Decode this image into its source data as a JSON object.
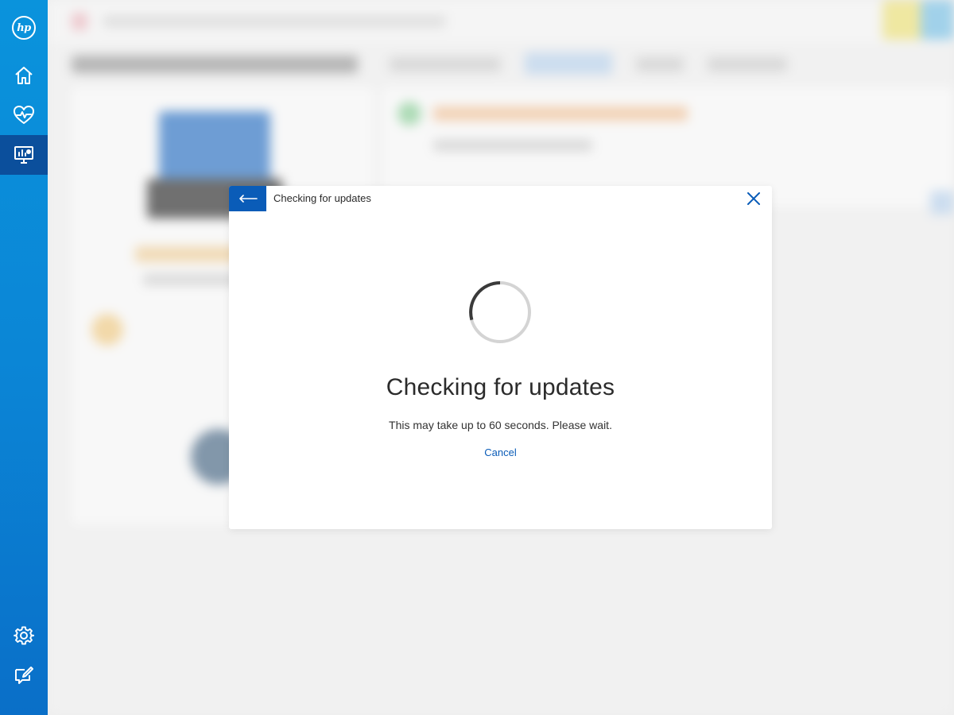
{
  "sidebar": {
    "logo": "hp",
    "items": [
      {
        "name": "home-icon"
      },
      {
        "name": "health-icon"
      },
      {
        "name": "device-support-icon",
        "active": true
      }
    ],
    "bottom_items": [
      {
        "name": "gear-icon"
      },
      {
        "name": "feedback-icon"
      }
    ]
  },
  "dialog": {
    "header_title": "Checking for updates",
    "title": "Checking for updates",
    "subtitle": "This may take up to 60 seconds. Please wait.",
    "cancel_label": "Cancel"
  },
  "colors": {
    "sidebar_top": "#0a93dc",
    "sidebar_bottom": "#0a6fc8",
    "sidebar_active": "#0b4f9c",
    "accent": "#0a5cb8",
    "spinner_track": "#d4d4d4",
    "spinner_arc": "#3a3a3a"
  }
}
